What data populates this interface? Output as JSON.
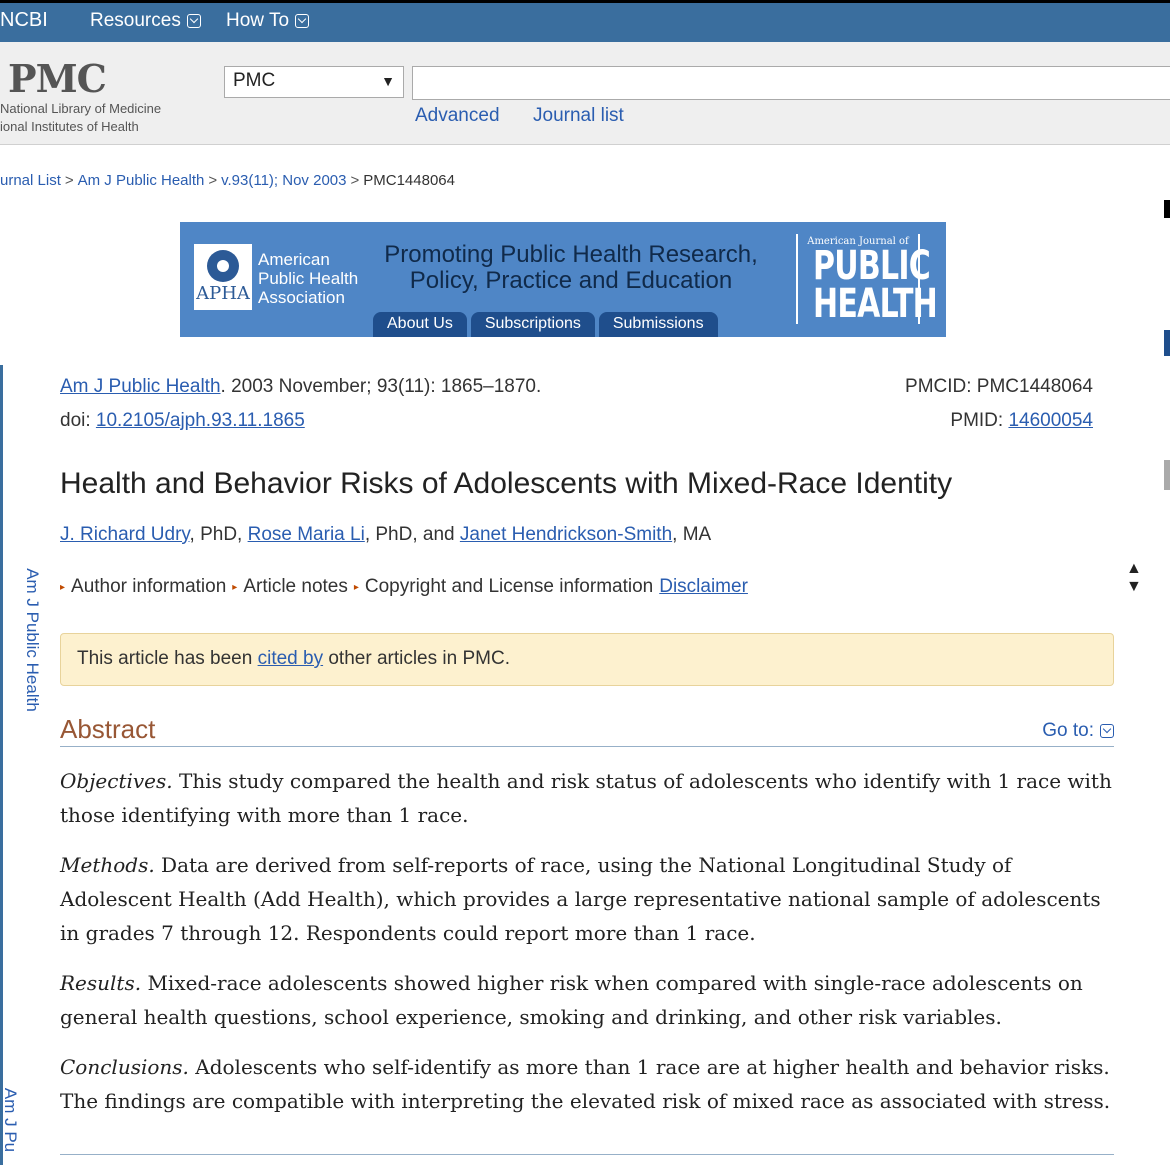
{
  "topbar": {
    "ncbi": "NCBI",
    "resources": "Resources",
    "howto": "How To"
  },
  "header": {
    "logo": "PMC",
    "nlm_line1": "National Library of Medicine",
    "nlm_line2": "ional Institutes of Health",
    "db_select_value": "PMC",
    "search_value": "",
    "advanced": "Advanced",
    "journal_list": "Journal list"
  },
  "breadcrumb": {
    "items": [
      "urnal List",
      "Am J Public Health",
      "v.93(11); Nov 2003",
      "PMC1448064"
    ],
    "sep": ">"
  },
  "banner": {
    "apha_logo_text": "APHA",
    "apha_name": [
      "American",
      "Public Health",
      "Association"
    ],
    "slogan_line1": "Promoting Public Health Research,",
    "slogan_line2": "Policy, Practice and Education",
    "tabs": [
      "About Us",
      "Subscriptions",
      "Submissions"
    ],
    "journal_small": "American Journal of",
    "journal_line1": "PUBLIC",
    "journal_line2": "HEALTH"
  },
  "sidebar": {
    "label": "Am J Public Health",
    "label2": "Am J Pu"
  },
  "article": {
    "journal_link": "Am J Public Health",
    "date_issue": ". 2003 November; 93(11): 1865–1870.",
    "doi_label": "doi: ",
    "doi": "10.2105/ajph.93.11.1865",
    "pmcid_label": "PMCID: ",
    "pmcid": "PMC1448064",
    "pmid_label": "PMID: ",
    "pmid": "14600054",
    "title": "Health and Behavior Risks of Adolescents with Mixed-Race Identity",
    "authors": [
      {
        "name": "J. Richard Udry",
        "suffix": ", PhD, "
      },
      {
        "name": "Rose Maria Li",
        "suffix": ", PhD, and "
      },
      {
        "name": "Janet Hendrickson-Smith",
        "suffix": ", MA"
      }
    ],
    "info": {
      "author_information": "Author information",
      "article_notes": "Article notes",
      "copyright": "Copyright and License information",
      "disclaimer": "Disclaimer"
    },
    "cited": {
      "prefix": "This article has been ",
      "link": "cited by",
      "suffix": " other articles in PMC."
    },
    "abstract": {
      "heading": "Abstract",
      "goto": "Go to:",
      "paragraphs": [
        {
          "lead": "Objectives.",
          "text": " This study compared the health and risk status of adolescents who identify with 1 race with those identifying with more than 1 race."
        },
        {
          "lead": "Methods.",
          "text": " Data are derived from self-reports of race, using the National Longitudinal Study of Adolescent Health (Add Health), which provides a large representative national sample of adolescents in grades 7 through 12. Respondents could report more than 1 race."
        },
        {
          "lead": "Results.",
          "text": " Mixed-race adolescents showed higher risk when compared with single-race adolescents on general health questions, school experience, smoking and drinking, and other risk variables."
        },
        {
          "lead": "Conclusions.",
          "text": " Adolescents who self-identify as more than 1 race are at higher health and behavior risks. The findings are compatible with interpreting the elevated risk of mixed race as associated with stress."
        }
      ]
    }
  },
  "colors": {
    "topbar": "#3a6e9e",
    "link": "#2a5db0",
    "abstract_heading": "#985735",
    "cited_bg": "#fdf1cf",
    "banner": "#4f86c6"
  }
}
